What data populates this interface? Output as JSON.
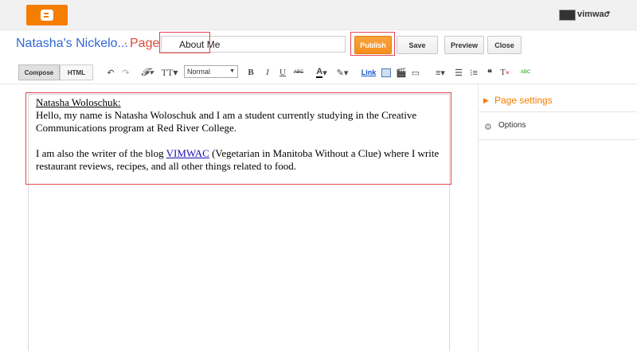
{
  "header": {
    "username": "vimwac"
  },
  "title_row": {
    "blog_title": "Natasha's Nickelo...",
    "separator": "·",
    "page_label": "Page",
    "title_value": "About Me",
    "publish": "Publish",
    "save": "Save",
    "preview": "Preview",
    "close": "Close"
  },
  "toolbar": {
    "compose": "Compose",
    "html": "HTML",
    "format_value": "Normal",
    "bold": "B",
    "italic": "I",
    "underline": "U",
    "strike": "ABC",
    "link": "Link",
    "spell": "ABC"
  },
  "editor": {
    "heading": "Natasha Woloschuk:",
    "line1": "Hello, my name is Natasha Woloschuk and I am a student currently studying in the Creative Communications program at Red River College.",
    "line2_before": "I am also the writer of the blog ",
    "link_text": "VIMWAC",
    "line2_after": " (Vegetarian in Manitoba Without a Clue) where I write restaurant reviews, recipes, and all other things related to food."
  },
  "sidebar": {
    "page_settings": "Page settings",
    "options": "Options"
  },
  "colors": {
    "accent": "#f57d00",
    "link": "#3367d6",
    "highlight": "#e3474f"
  }
}
